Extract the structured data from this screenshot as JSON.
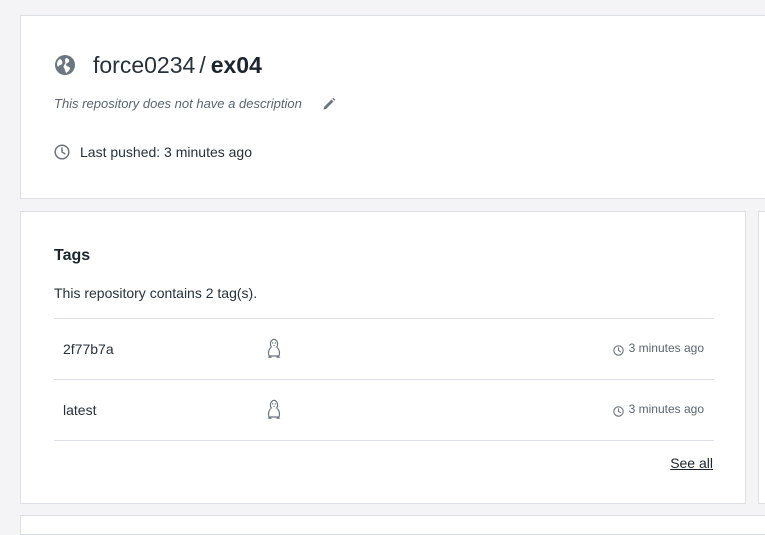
{
  "repo": {
    "owner": "force0234",
    "separator": "/",
    "name": "ex04",
    "visibility_icon": "globe-icon",
    "description": "This repository does not have a description",
    "last_pushed": "Last pushed: 3 minutes ago"
  },
  "tags": {
    "title": "Tags",
    "count_text": "This repository contains 2 tag(s).",
    "items": [
      {
        "name": "2f77b7a",
        "os_icon": "linux-icon",
        "time": "3 minutes ago"
      },
      {
        "name": "latest",
        "os_icon": "linux-icon",
        "time": "3 minutes ago"
      }
    ],
    "see_all_label": "See all"
  },
  "colors": {
    "background": "#f4f4f6",
    "card": "#ffffff",
    "border": "#dcdfe3",
    "text": "#27313b",
    "muted": "#5a6570",
    "icon": "#6b7680"
  }
}
